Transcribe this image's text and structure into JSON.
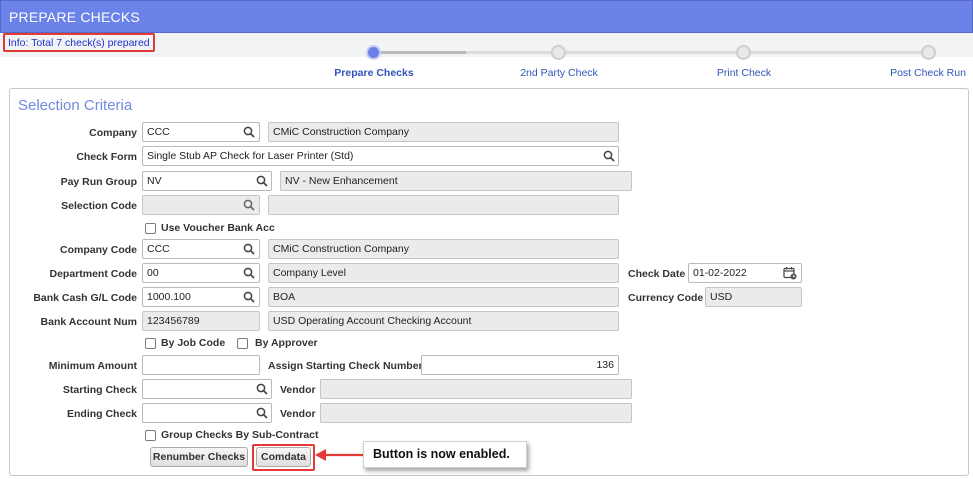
{
  "window": {
    "title": "PREPARE CHECKS"
  },
  "info_message": "Info: Total 7 check(s) prepared",
  "steps": [
    {
      "label": "Prepare Checks",
      "active": true
    },
    {
      "label": "2nd Party Check",
      "active": false
    },
    {
      "label": "Print Check",
      "active": false
    },
    {
      "label": "Post Check Run",
      "active": false
    }
  ],
  "section": {
    "title": "Selection Criteria"
  },
  "form": {
    "company": {
      "label": "Company",
      "value": "CCC",
      "desc": "CMiC Construction Company"
    },
    "check_form": {
      "label": "Check Form",
      "value": "Single Stub AP Check for Laser Printer (Std)"
    },
    "pay_run_group": {
      "label": "Pay Run Group",
      "value": "NV",
      "desc": "NV - New Enhancement"
    },
    "selection_code": {
      "label": "Selection Code",
      "value": "",
      "desc": ""
    },
    "use_voucher_bank_acc": {
      "label": "Use Voucher Bank Acc",
      "checked": false
    },
    "company_code": {
      "label": "Company Code",
      "value": "CCC",
      "desc": "CMiC Construction Company"
    },
    "department_code": {
      "label": "Department Code",
      "value": "00",
      "desc": "Company Level"
    },
    "check_date": {
      "label": "Check Date",
      "value": "01-02-2022"
    },
    "bank_cash_gl_code": {
      "label": "Bank Cash G/L Code",
      "value": "1000.100",
      "desc": "BOA"
    },
    "currency_code": {
      "label": "Currency Code",
      "value": "USD"
    },
    "bank_account_num": {
      "label": "Bank Account Num",
      "value": "123456789",
      "desc": "USD Operating Account Checking Account"
    },
    "by_job_code": {
      "label": "By Job Code",
      "checked": false
    },
    "by_approver": {
      "label": "By Approver",
      "checked": false
    },
    "minimum_amount": {
      "label": "Minimum Amount",
      "value": ""
    },
    "assign_starting_check_number": {
      "label": "Assign Starting Check Number",
      "value": "136"
    },
    "starting_check": {
      "label": "Starting Check",
      "value": "",
      "vendor_label": "Vendor",
      "vendor_value": ""
    },
    "ending_check": {
      "label": "Ending Check",
      "value": "",
      "vendor_label": "Vendor",
      "vendor_value": ""
    },
    "group_checks_by_sub_contract": {
      "label": "Group Checks By Sub-Contract",
      "checked": false
    }
  },
  "buttons": {
    "renumber_checks": "Renumber Checks",
    "comdata": "Comdata"
  },
  "annotation": {
    "callout_text": "Button is now enabled."
  },
  "colors": {
    "title_bar": "#6b82e8",
    "info_text": "#1f2fd0",
    "step_label": "#2f55b8",
    "section_title": "#6f8be0",
    "highlight": "#e53935"
  },
  "icons": [
    "search-icon",
    "calendar-icon",
    "arrow-left-icon"
  ]
}
